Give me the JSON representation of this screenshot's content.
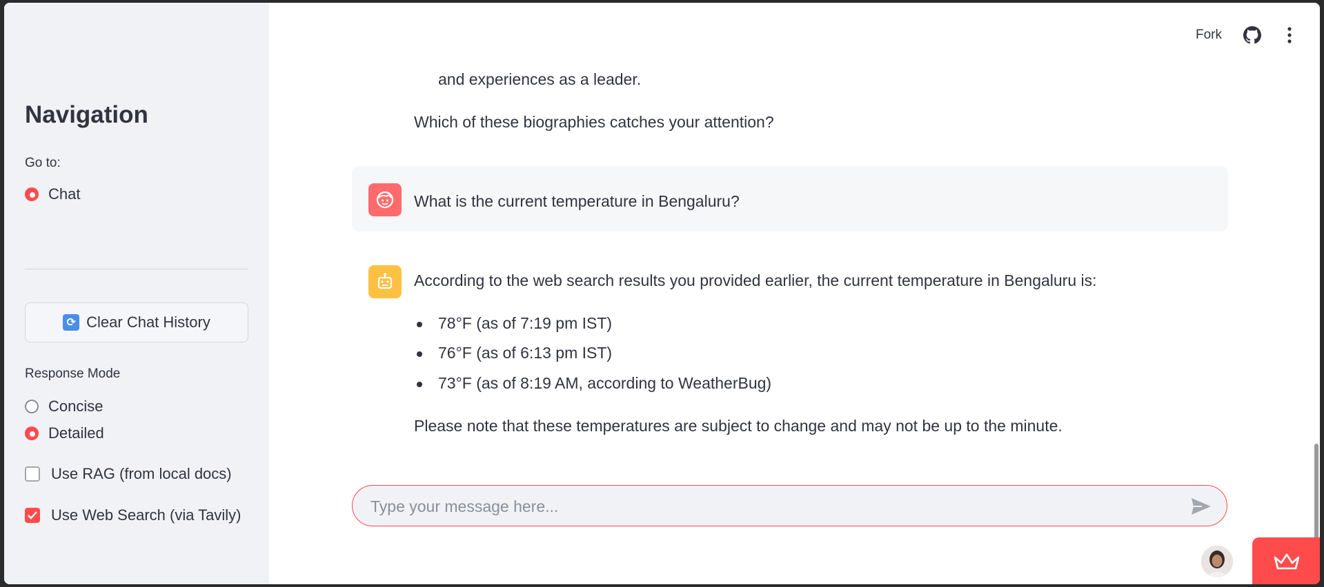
{
  "sidebar": {
    "title": "Navigation",
    "goto_label": "Go to:",
    "goto_options": [
      {
        "label": "Chat",
        "selected": true
      }
    ],
    "clear_button": "Clear Chat History",
    "response_mode_label": "Response Mode",
    "response_modes": [
      {
        "label": "Concise",
        "selected": false
      },
      {
        "label": "Detailed",
        "selected": true
      }
    ],
    "checkboxes": [
      {
        "label": "Use RAG (from local docs)",
        "checked": false
      },
      {
        "label": "Use Web Search (via Tavily)",
        "checked": true
      }
    ]
  },
  "header": {
    "fork_label": "Fork",
    "github_icon": "github-icon",
    "menu_icon": "kebab-menu-icon"
  },
  "chat": {
    "prev_fragment": "and experiences as a leader.",
    "prev_question": "Which of these biographies catches your attention?",
    "user_message": "What is the current temperature in Bengaluru?",
    "assistant_intro": "According to the web search results you provided earlier, the current temperature in Bengaluru is:",
    "assistant_bullets": [
      "78°F (as of 7:19 pm IST)",
      "76°F (as of 6:13 pm IST)",
      "73°F (as of 8:19 AM, according to WeatherBug)"
    ],
    "assistant_note": "Please note that these temperatures are subject to change and may not be up to the minute."
  },
  "input": {
    "placeholder": "Type your message here..."
  },
  "colors": {
    "accent": "#ff4b4b",
    "sidebar_bg": "#f0f2f6",
    "user_avatar": "#ff6b6b",
    "bot_avatar": "#fdc142"
  }
}
